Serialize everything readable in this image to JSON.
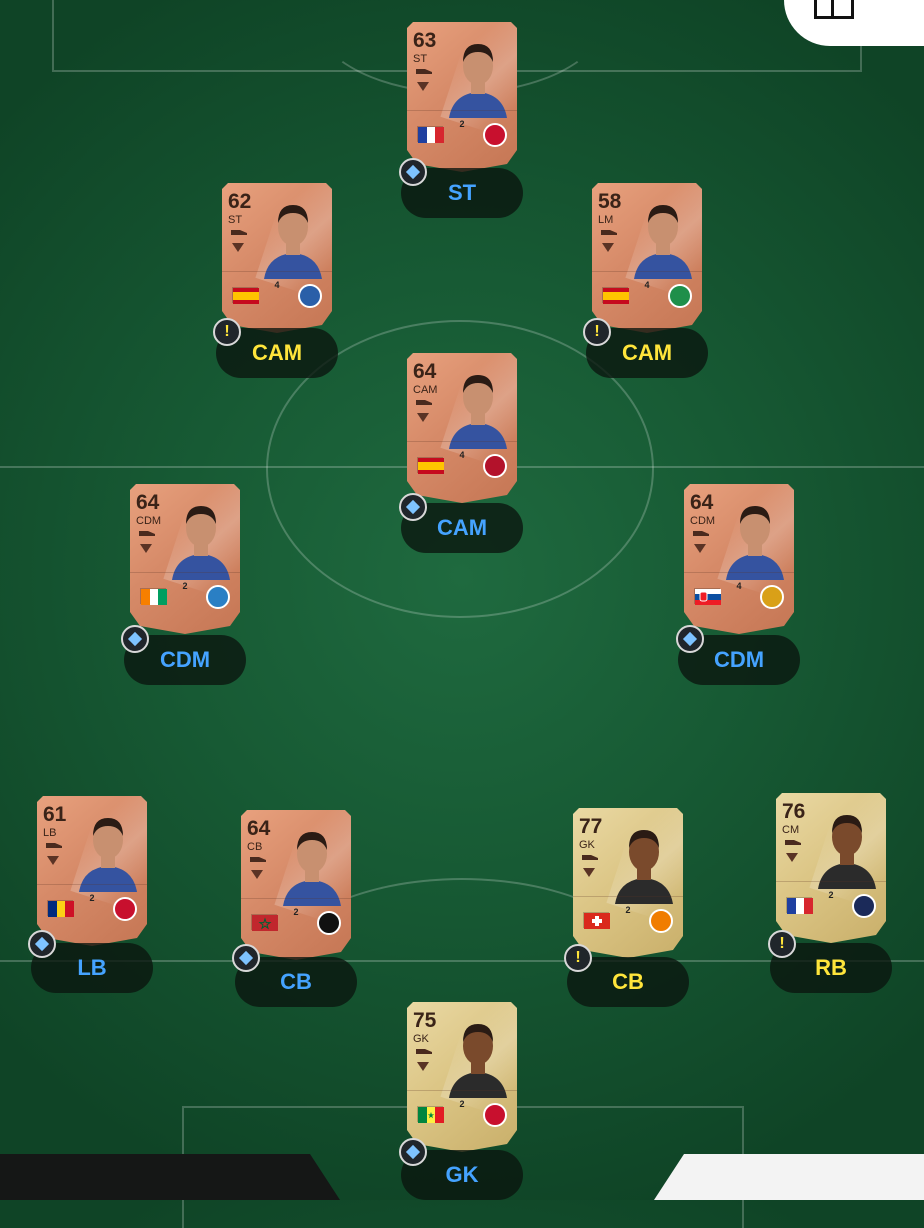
{
  "slots": [
    {
      "ovr": "63",
      "pos": "ST",
      "slot": "ST",
      "tier": "bronze",
      "warn": false,
      "flag": "france",
      "league": "ligue2",
      "club_color": "#c8102e"
    },
    {
      "ovr": "62",
      "pos": "ST",
      "slot": "CAM",
      "tier": "bronze",
      "warn": true,
      "flag": "spain",
      "league": "laliga",
      "club_color": "#2a5fa8"
    },
    {
      "ovr": "58",
      "pos": "LM",
      "slot": "CAM",
      "tier": "bronze",
      "warn": true,
      "flag": "spain",
      "league": "laliga",
      "club_color": "#1e8f4a"
    },
    {
      "ovr": "64",
      "pos": "CAM",
      "slot": "CAM",
      "tier": "bronze",
      "warn": false,
      "flag": "spain",
      "league": "laliga",
      "club_color": "#b3122b"
    },
    {
      "ovr": "64",
      "pos": "CDM",
      "slot": "CDM",
      "tier": "bronze",
      "warn": false,
      "flag": "ivory_coast",
      "league": "ligue2",
      "club_color": "#2a7fc4"
    },
    {
      "ovr": "64",
      "pos": "CDM",
      "slot": "CDM",
      "tier": "bronze",
      "warn": false,
      "flag": "slovakia",
      "league": "laliga",
      "club_color": "#d9a018"
    },
    {
      "ovr": "61",
      "pos": "LB",
      "slot": "LB",
      "tier": "bronze",
      "warn": false,
      "flag": "romania",
      "league": "ligue2",
      "club_color": "#c8102e"
    },
    {
      "ovr": "64",
      "pos": "CB",
      "slot": "CB",
      "tier": "bronze",
      "warn": false,
      "flag": "morocco",
      "league": "ligue2",
      "club_color": "#111111"
    },
    {
      "ovr": "77",
      "pos": "GK",
      "slot": "CB",
      "tier": "gold",
      "warn": true,
      "flag": "switzerland",
      "league": "ligue2",
      "club_color": "#f07d00"
    },
    {
      "ovr": "76",
      "pos": "CM",
      "slot": "RB",
      "tier": "gold",
      "warn": true,
      "flag": "france",
      "league": "ligue2",
      "club_color": "#1b2a59"
    },
    {
      "ovr": "75",
      "pos": "GK",
      "slot": "GK",
      "tier": "gold",
      "warn": false,
      "flag": "senegal",
      "league": "ligue2",
      "club_color": "#c8102e"
    }
  ],
  "league_marks": {
    "ligue2": "2",
    "laliga": "4"
  },
  "warn_mark": "!"
}
